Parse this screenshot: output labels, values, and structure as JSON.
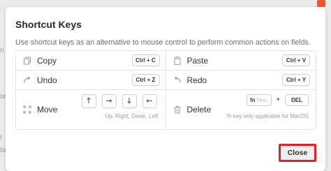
{
  "background": {
    "fragments": [
      "n",
      "or",
      "t",
      "ta"
    ]
  },
  "modal": {
    "title": "Shortcut Keys",
    "description": "Use shortcut keys as an alternative to mouse control to perform common actions on fields.",
    "close_label": "Close"
  },
  "shortcuts": {
    "copy": {
      "label": "Copy",
      "keys": "Ctrl + C",
      "icon": "copy-icon"
    },
    "paste": {
      "label": "Paste",
      "keys": "Ctrl + V",
      "icon": "paste-icon"
    },
    "undo": {
      "label": "Undo",
      "keys": "Ctrl + Z",
      "icon": "undo-icon"
    },
    "redo": {
      "label": "Redo",
      "keys": "Ctrl + Y",
      "icon": "redo-icon"
    },
    "move": {
      "label": "Move",
      "icon": "move-icon",
      "arrows": [
        "↑",
        "→",
        "↓",
        "←"
      ],
      "hint": "Up, Right, Down, Left"
    },
    "delete": {
      "label": "Delete",
      "icon": "trash-icon",
      "fn_key": "fn",
      "fn_sub": "Mac",
      "plus": "+",
      "del_key": "DEL",
      "hint": "fn key only applicable for MacOS"
    }
  },
  "colors": {
    "highlight": "#e61e2b",
    "border": "#e4e4e4"
  }
}
